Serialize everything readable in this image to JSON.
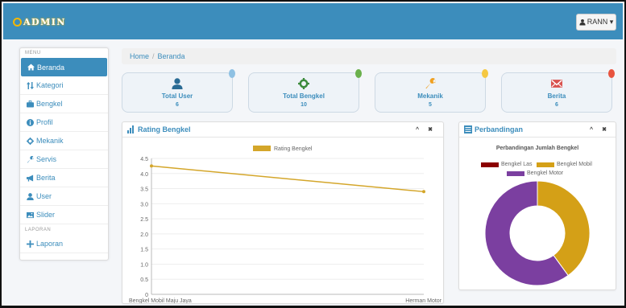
{
  "app": {
    "brand": "ADMIN"
  },
  "topbar": {
    "user_label": "RANN ▾"
  },
  "sidebar": {
    "menu_header": "MENU",
    "report_header": "LAPORAN",
    "items": [
      {
        "label": "Beranda",
        "icon": "home-icon"
      },
      {
        "label": "Kategori",
        "icon": "sort-icon"
      },
      {
        "label": "Bengkel",
        "icon": "briefcase-icon"
      },
      {
        "label": "Profil",
        "icon": "info-icon"
      },
      {
        "label": "Mekanik",
        "icon": "gear-icon"
      },
      {
        "label": "Servis",
        "icon": "wrench-icon"
      },
      {
        "label": "Berita",
        "icon": "bullhorn-icon"
      },
      {
        "label": "User",
        "icon": "user-icon"
      },
      {
        "label": "Slider",
        "icon": "image-icon"
      }
    ],
    "report_item": {
      "label": "Laporan",
      "icon": "plus-icon"
    }
  },
  "breadcrumb": {
    "home": "Home",
    "current": "Beranda"
  },
  "stats": [
    {
      "title": "Total User",
      "value": "6",
      "icon": "user-icon",
      "dot_color": "#8fc1e3"
    },
    {
      "title": "Total Bengkel",
      "value": "10",
      "icon": "gear-icon",
      "dot_color": "#6ab04c"
    },
    {
      "title": "Mekanik",
      "value": "5",
      "icon": "wrench-icon",
      "dot_color": "#f5c842"
    },
    {
      "title": "Berita",
      "value": "6",
      "icon": "envelope-icon",
      "dot_color": "#e8543f"
    }
  ],
  "rating_panel": {
    "title": "Rating Bengkel",
    "collapse_label": "^",
    "close_label": "✖"
  },
  "comparison_panel": {
    "title": "Perbandingan",
    "collapse_label": "^",
    "close_label": "✖",
    "chart_title": "Perbandingan Jumlah Bengkel"
  },
  "colors": {
    "primary": "#3c8dbc",
    "line": "#d4a62a",
    "las": "#8b0000",
    "mobil": "#d4a017",
    "motor": "#7b3fa0"
  },
  "chart_data": [
    {
      "type": "line",
      "categories": [
        "Bengkel Mobil Maju Jaya",
        "Herman Motor"
      ],
      "series": [
        {
          "name": "Rating Bengkel",
          "values": [
            4.25,
            3.4
          ]
        }
      ],
      "ylim": [
        0,
        4.5
      ],
      "yticks": [
        "0",
        "0.5",
        "1.0",
        "1.5",
        "2.0",
        "2.5",
        "3.0",
        "3.5",
        "4.0",
        "4.5"
      ],
      "legend": "top",
      "grid": true
    },
    {
      "type": "pie",
      "title": "Perbandingan Jumlah Bengkel",
      "labels": [
        "Bengkel Las",
        "Bengkel Mobil",
        "Bengkel Motor"
      ],
      "values": [
        0,
        4,
        6
      ],
      "colors": [
        "#8b0000",
        "#d4a017",
        "#7b3fa0"
      ],
      "donut": true,
      "legend": "top"
    }
  ]
}
